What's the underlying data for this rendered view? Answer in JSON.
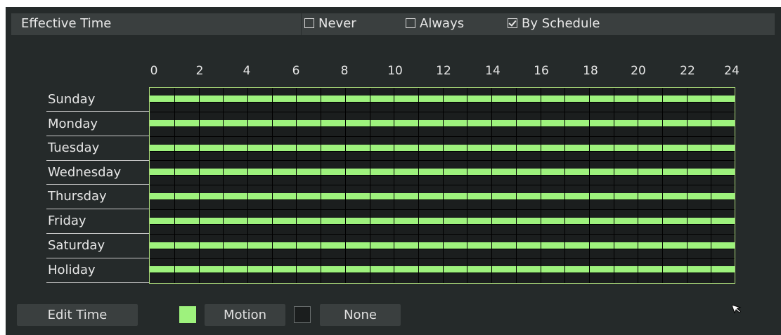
{
  "header": {
    "title": "Effective Time",
    "options": [
      {
        "label": "Never",
        "checked": false
      },
      {
        "label": "Always",
        "checked": false
      },
      {
        "label": "By Schedule",
        "checked": true
      }
    ]
  },
  "schedule": {
    "hour_labels": [
      "0",
      "2",
      "4",
      "6",
      "8",
      "10",
      "12",
      "14",
      "16",
      "18",
      "20",
      "22",
      "24"
    ],
    "days": [
      "Sunday",
      "Monday",
      "Tuesday",
      "Wednesday",
      "Thursday",
      "Friday",
      "Saturday",
      "Holiday"
    ],
    "active_color": "#9ef27d",
    "coverage": "all days 0-24 Motion"
  },
  "footer": {
    "edit_button": "Edit Time",
    "motion_label": "Motion",
    "motion_color": "#9ef27d",
    "none_label": "None",
    "none_color": "#1b1e1e"
  },
  "icons": {
    "cursor": "mouse-pointer-icon"
  }
}
